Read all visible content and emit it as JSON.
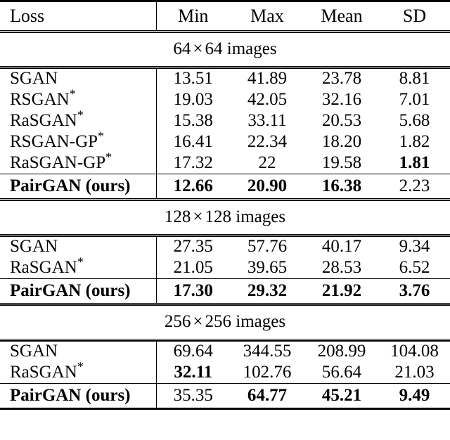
{
  "table": {
    "columns": [
      "Loss",
      "Min",
      "Max",
      "Mean",
      "SD"
    ],
    "sections": [
      {
        "header": "64 × 64 images",
        "header_parts": {
          "size_a": "64",
          "times": "×",
          "size_b": "64",
          "suffix": "images"
        },
        "rows": [
          {
            "label": "SGAN",
            "star": "",
            "label_bold": false,
            "values": [
              "13.51",
              "41.89",
              "23.78",
              "8.81"
            ],
            "bold": [
              false,
              false,
              false,
              false
            ]
          },
          {
            "label": "RSGAN",
            "star": "*",
            "label_bold": false,
            "values": [
              "19.03",
              "42.05",
              "32.16",
              "7.01"
            ],
            "bold": [
              false,
              false,
              false,
              false
            ]
          },
          {
            "label": "RaSGAN",
            "star": "*",
            "label_bold": false,
            "values": [
              "15.38",
              "33.11",
              "20.53",
              "5.68"
            ],
            "bold": [
              false,
              false,
              false,
              false
            ]
          },
          {
            "label": "RSGAN-GP",
            "star": "*",
            "label_bold": false,
            "values": [
              "16.41",
              "22.34",
              "18.20",
              "1.82"
            ],
            "bold": [
              false,
              false,
              false,
              false
            ]
          },
          {
            "label": "RaSGAN-GP",
            "star": "*",
            "label_bold": false,
            "values": [
              "17.32",
              "22",
              "19.58",
              "1.81"
            ],
            "bold": [
              false,
              false,
              false,
              true
            ]
          }
        ],
        "highlight_row": {
          "label": "PairGAN (ours)",
          "star": "",
          "label_bold": true,
          "values": [
            "12.66",
            "20.90",
            "16.38",
            "2.23"
          ],
          "bold": [
            true,
            true,
            true,
            false
          ]
        }
      },
      {
        "header": "128 × 128 images",
        "header_parts": {
          "size_a": "128",
          "times": "×",
          "size_b": "128",
          "suffix": "images"
        },
        "rows": [
          {
            "label": "SGAN",
            "star": "",
            "label_bold": false,
            "values": [
              "27.35",
              "57.76",
              "40.17",
              "9.34"
            ],
            "bold": [
              false,
              false,
              false,
              false
            ]
          },
          {
            "label": "RaSGAN",
            "star": "*",
            "label_bold": false,
            "values": [
              "21.05",
              "39.65",
              "28.53",
              "6.52"
            ],
            "bold": [
              false,
              false,
              false,
              false
            ]
          }
        ],
        "highlight_row": {
          "label": "PairGAN (ours)",
          "star": "",
          "label_bold": true,
          "values": [
            "17.30",
            "29.32",
            "21.92",
            "3.76"
          ],
          "bold": [
            true,
            true,
            true,
            true
          ]
        }
      },
      {
        "header": "256 × 256 images",
        "header_parts": {
          "size_a": "256",
          "times": "×",
          "size_b": "256",
          "suffix": "images"
        },
        "rows": [
          {
            "label": "SGAN",
            "star": "",
            "label_bold": false,
            "values": [
              "69.64",
              "344.55",
              "208.99",
              "104.08"
            ],
            "bold": [
              false,
              false,
              false,
              false
            ]
          },
          {
            "label": "RaSGAN",
            "star": "*",
            "label_bold": false,
            "values": [
              "32.11",
              "102.76",
              "56.64",
              "21.03"
            ],
            "bold": [
              true,
              false,
              false,
              false
            ]
          }
        ],
        "highlight_row": {
          "label": "PairGAN (ours)",
          "star": "",
          "label_bold": true,
          "values": [
            "35.35",
            "64.77",
            "45.21",
            "9.49"
          ],
          "bold": [
            false,
            true,
            true,
            true
          ]
        }
      }
    ]
  }
}
